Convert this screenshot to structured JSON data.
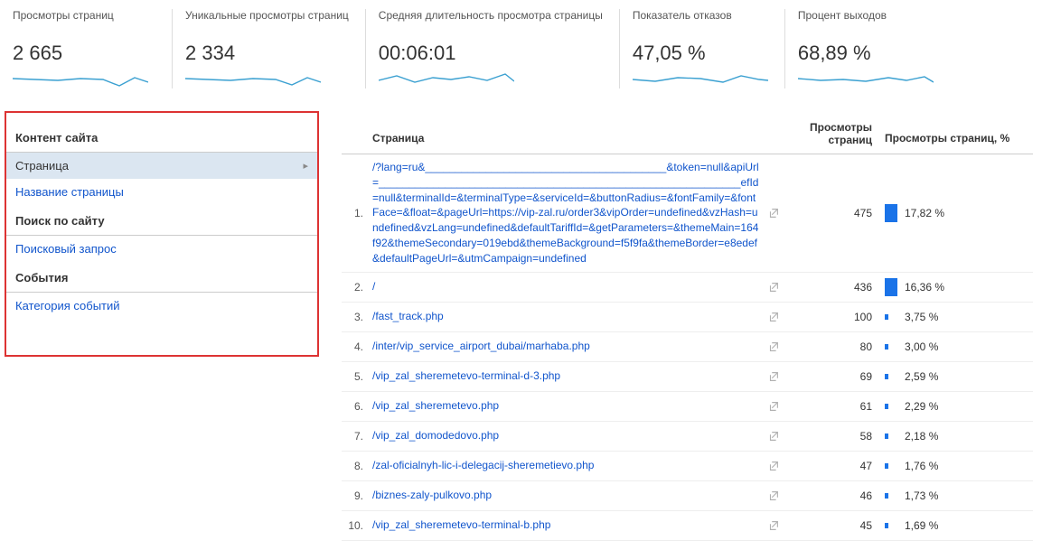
{
  "metrics": [
    {
      "label": "Просмотры страниц",
      "value": "2 665"
    },
    {
      "label": "Уникальные просмотры страниц",
      "value": "2 334"
    },
    {
      "label": "Средняя длительность просмотра страницы",
      "value": "00:06:01"
    },
    {
      "label": "Показатель отказов",
      "value": "47,05 %"
    },
    {
      "label": "Процент выходов",
      "value": "68,89 %"
    }
  ],
  "sidebar": {
    "section1_title": "Контент сайта",
    "section1_items": [
      {
        "label": "Страница",
        "active": true
      },
      {
        "label": "Название страницы",
        "active": false
      }
    ],
    "section2_title": "Поиск по сайту",
    "section2_items": [
      {
        "label": "Поисковый запрос",
        "active": false
      }
    ],
    "section3_title": "События",
    "section3_items": [
      {
        "label": "Категория событий",
        "active": false
      }
    ]
  },
  "table": {
    "head_page": "Страница",
    "head_views": "Просмотры страниц",
    "head_pct": "Просмотры страниц, %",
    "rows": [
      {
        "idx": "1.",
        "page": "/?lang=ru&________________________________________&token=null&apiUrl=____________________________________________________________efId=null&terminalId=&terminalType=&serviceId=&buttonRadius=&fontFamily=&fontFace=&float=&pageUrl=https://vip-zal.ru/order3&vipOrder=undefined&vzHash=undefined&vzLang=undefined&defaultTariffId=&getParameters=&themeMain=164f92&themeSecondary=019ebd&themeBackground=f5f9fa&themeBorder=e8edef&defaultPageUrl=&utmCampaign=undefined",
        "views": "475",
        "pct": "17,82 %",
        "barBig": true
      },
      {
        "idx": "2.",
        "page": "/",
        "views": "436",
        "pct": "16,36 %",
        "barBig": true
      },
      {
        "idx": "3.",
        "page": "/fast_track.php",
        "views": "100",
        "pct": "3,75 %",
        "barBig": false
      },
      {
        "idx": "4.",
        "page": "/inter/vip_service_airport_dubai/marhaba.php",
        "views": "80",
        "pct": "3,00 %",
        "barBig": false
      },
      {
        "idx": "5.",
        "page": "/vip_zal_sheremetevo-terminal-d-3.php",
        "views": "69",
        "pct": "2,59 %",
        "barBig": false
      },
      {
        "idx": "6.",
        "page": "/vip_zal_sheremetevo.php",
        "views": "61",
        "pct": "2,29 %",
        "barBig": false
      },
      {
        "idx": "7.",
        "page": "/vip_zal_domodedovo.php",
        "views": "58",
        "pct": "2,18 %",
        "barBig": false
      },
      {
        "idx": "8.",
        "page": "/zal-oficialnyh-lic-i-delegacij-sheremetievo.php",
        "views": "47",
        "pct": "1,76 %",
        "barBig": false
      },
      {
        "idx": "9.",
        "page": "/biznes-zaly-pulkovo.php",
        "views": "46",
        "pct": "1,73 %",
        "barBig": false
      },
      {
        "idx": "10.",
        "page": "/vip_zal_sheremetevo-terminal-b.php",
        "views": "45",
        "pct": "1,69 %",
        "barBig": false
      }
    ]
  }
}
